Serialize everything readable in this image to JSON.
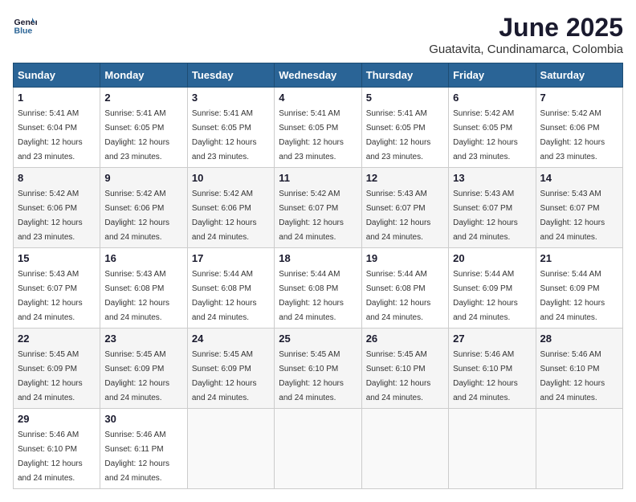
{
  "logo": {
    "line1": "General",
    "line2": "Blue"
  },
  "title": "June 2025",
  "location": "Guatavita, Cundinamarca, Colombia",
  "weekdays": [
    "Sunday",
    "Monday",
    "Tuesday",
    "Wednesday",
    "Thursday",
    "Friday",
    "Saturday"
  ],
  "weeks": [
    [
      {
        "day": "1",
        "sunrise": "Sunrise: 5:41 AM",
        "sunset": "Sunset: 6:04 PM",
        "daylight": "Daylight: 12 hours and 23 minutes."
      },
      {
        "day": "2",
        "sunrise": "Sunrise: 5:41 AM",
        "sunset": "Sunset: 6:05 PM",
        "daylight": "Daylight: 12 hours and 23 minutes."
      },
      {
        "day": "3",
        "sunrise": "Sunrise: 5:41 AM",
        "sunset": "Sunset: 6:05 PM",
        "daylight": "Daylight: 12 hours and 23 minutes."
      },
      {
        "day": "4",
        "sunrise": "Sunrise: 5:41 AM",
        "sunset": "Sunset: 6:05 PM",
        "daylight": "Daylight: 12 hours and 23 minutes."
      },
      {
        "day": "5",
        "sunrise": "Sunrise: 5:41 AM",
        "sunset": "Sunset: 6:05 PM",
        "daylight": "Daylight: 12 hours and 23 minutes."
      },
      {
        "day": "6",
        "sunrise": "Sunrise: 5:42 AM",
        "sunset": "Sunset: 6:05 PM",
        "daylight": "Daylight: 12 hours and 23 minutes."
      },
      {
        "day": "7",
        "sunrise": "Sunrise: 5:42 AM",
        "sunset": "Sunset: 6:06 PM",
        "daylight": "Daylight: 12 hours and 23 minutes."
      }
    ],
    [
      {
        "day": "8",
        "sunrise": "Sunrise: 5:42 AM",
        "sunset": "Sunset: 6:06 PM",
        "daylight": "Daylight: 12 hours and 23 minutes."
      },
      {
        "day": "9",
        "sunrise": "Sunrise: 5:42 AM",
        "sunset": "Sunset: 6:06 PM",
        "daylight": "Daylight: 12 hours and 24 minutes."
      },
      {
        "day": "10",
        "sunrise": "Sunrise: 5:42 AM",
        "sunset": "Sunset: 6:06 PM",
        "daylight": "Daylight: 12 hours and 24 minutes."
      },
      {
        "day": "11",
        "sunrise": "Sunrise: 5:42 AM",
        "sunset": "Sunset: 6:07 PM",
        "daylight": "Daylight: 12 hours and 24 minutes."
      },
      {
        "day": "12",
        "sunrise": "Sunrise: 5:43 AM",
        "sunset": "Sunset: 6:07 PM",
        "daylight": "Daylight: 12 hours and 24 minutes."
      },
      {
        "day": "13",
        "sunrise": "Sunrise: 5:43 AM",
        "sunset": "Sunset: 6:07 PM",
        "daylight": "Daylight: 12 hours and 24 minutes."
      },
      {
        "day": "14",
        "sunrise": "Sunrise: 5:43 AM",
        "sunset": "Sunset: 6:07 PM",
        "daylight": "Daylight: 12 hours and 24 minutes."
      }
    ],
    [
      {
        "day": "15",
        "sunrise": "Sunrise: 5:43 AM",
        "sunset": "Sunset: 6:07 PM",
        "daylight": "Daylight: 12 hours and 24 minutes."
      },
      {
        "day": "16",
        "sunrise": "Sunrise: 5:43 AM",
        "sunset": "Sunset: 6:08 PM",
        "daylight": "Daylight: 12 hours and 24 minutes."
      },
      {
        "day": "17",
        "sunrise": "Sunrise: 5:44 AM",
        "sunset": "Sunset: 6:08 PM",
        "daylight": "Daylight: 12 hours and 24 minutes."
      },
      {
        "day": "18",
        "sunrise": "Sunrise: 5:44 AM",
        "sunset": "Sunset: 6:08 PM",
        "daylight": "Daylight: 12 hours and 24 minutes."
      },
      {
        "day": "19",
        "sunrise": "Sunrise: 5:44 AM",
        "sunset": "Sunset: 6:08 PM",
        "daylight": "Daylight: 12 hours and 24 minutes."
      },
      {
        "day": "20",
        "sunrise": "Sunrise: 5:44 AM",
        "sunset": "Sunset: 6:09 PM",
        "daylight": "Daylight: 12 hours and 24 minutes."
      },
      {
        "day": "21",
        "sunrise": "Sunrise: 5:44 AM",
        "sunset": "Sunset: 6:09 PM",
        "daylight": "Daylight: 12 hours and 24 minutes."
      }
    ],
    [
      {
        "day": "22",
        "sunrise": "Sunrise: 5:45 AM",
        "sunset": "Sunset: 6:09 PM",
        "daylight": "Daylight: 12 hours and 24 minutes."
      },
      {
        "day": "23",
        "sunrise": "Sunrise: 5:45 AM",
        "sunset": "Sunset: 6:09 PM",
        "daylight": "Daylight: 12 hours and 24 minutes."
      },
      {
        "day": "24",
        "sunrise": "Sunrise: 5:45 AM",
        "sunset": "Sunset: 6:09 PM",
        "daylight": "Daylight: 12 hours and 24 minutes."
      },
      {
        "day": "25",
        "sunrise": "Sunrise: 5:45 AM",
        "sunset": "Sunset: 6:10 PM",
        "daylight": "Daylight: 12 hours and 24 minutes."
      },
      {
        "day": "26",
        "sunrise": "Sunrise: 5:45 AM",
        "sunset": "Sunset: 6:10 PM",
        "daylight": "Daylight: 12 hours and 24 minutes."
      },
      {
        "day": "27",
        "sunrise": "Sunrise: 5:46 AM",
        "sunset": "Sunset: 6:10 PM",
        "daylight": "Daylight: 12 hours and 24 minutes."
      },
      {
        "day": "28",
        "sunrise": "Sunrise: 5:46 AM",
        "sunset": "Sunset: 6:10 PM",
        "daylight": "Daylight: 12 hours and 24 minutes."
      }
    ],
    [
      {
        "day": "29",
        "sunrise": "Sunrise: 5:46 AM",
        "sunset": "Sunset: 6:10 PM",
        "daylight": "Daylight: 12 hours and 24 minutes."
      },
      {
        "day": "30",
        "sunrise": "Sunrise: 5:46 AM",
        "sunset": "Sunset: 6:11 PM",
        "daylight": "Daylight: 12 hours and 24 minutes."
      },
      null,
      null,
      null,
      null,
      null
    ]
  ]
}
